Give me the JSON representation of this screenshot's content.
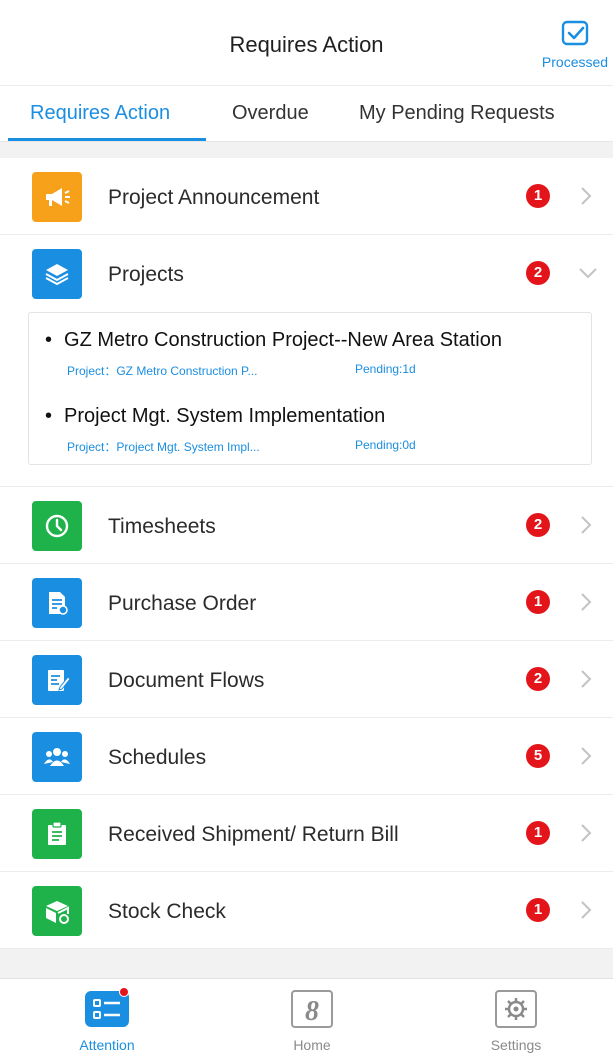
{
  "header": {
    "title": "Requires Action",
    "processed_label": "Processed"
  },
  "tabs": [
    {
      "label": "Requires Action",
      "active": true
    },
    {
      "label": "Overdue",
      "active": false
    },
    {
      "label": "My Pending Requests",
      "active": false
    }
  ],
  "items": [
    {
      "label": "Project Announcement",
      "badge": "1",
      "icon": "megaphone-icon",
      "color": "#f7a11a",
      "expanded": false
    },
    {
      "label": "Projects",
      "badge": "2",
      "icon": "layers-icon",
      "color": "#1a8ee0",
      "expanded": true
    },
    {
      "label": "Timesheets",
      "badge": "2",
      "icon": "clock-icon",
      "color": "#1fb24a",
      "expanded": false
    },
    {
      "label": "Purchase Order",
      "badge": "1",
      "icon": "document-icon",
      "color": "#1a8ee0",
      "expanded": false
    },
    {
      "label": "Document Flows",
      "badge": "2",
      "icon": "edit-document-icon",
      "color": "#1a8ee0",
      "expanded": false
    },
    {
      "label": "Schedules",
      "badge": "5",
      "icon": "people-icon",
      "color": "#1a8ee0",
      "expanded": false
    },
    {
      "label": "Received Shipment/ Return Bill",
      "badge": "1",
      "icon": "clipboard-icon",
      "color": "#1fb24a",
      "expanded": false
    },
    {
      "label": "Stock Check",
      "badge": "1",
      "icon": "box-icon",
      "color": "#1fb24a",
      "expanded": false
    }
  ],
  "projects_sub": [
    {
      "title": "GZ Metro Construction Project--New Area Station",
      "project": "Project：GZ Metro Construction P...",
      "pending": "Pending:1d"
    },
    {
      "title": "Project Mgt. System Implementation",
      "project": "Project：Project Mgt. System Impl...",
      "pending": "Pending:0d"
    }
  ],
  "bottom_nav": [
    {
      "label": "Attention",
      "icon": "list-icon",
      "active": true,
      "has_dot": true
    },
    {
      "label": "Home",
      "icon": "home-logo-icon",
      "active": false,
      "glyph": "8"
    },
    {
      "label": "Settings",
      "icon": "gear-icon",
      "active": false
    }
  ],
  "colors": {
    "accent": "#1a8ee0",
    "badge": "#e3151a",
    "orange": "#f7a11a",
    "green": "#1fb24a"
  }
}
